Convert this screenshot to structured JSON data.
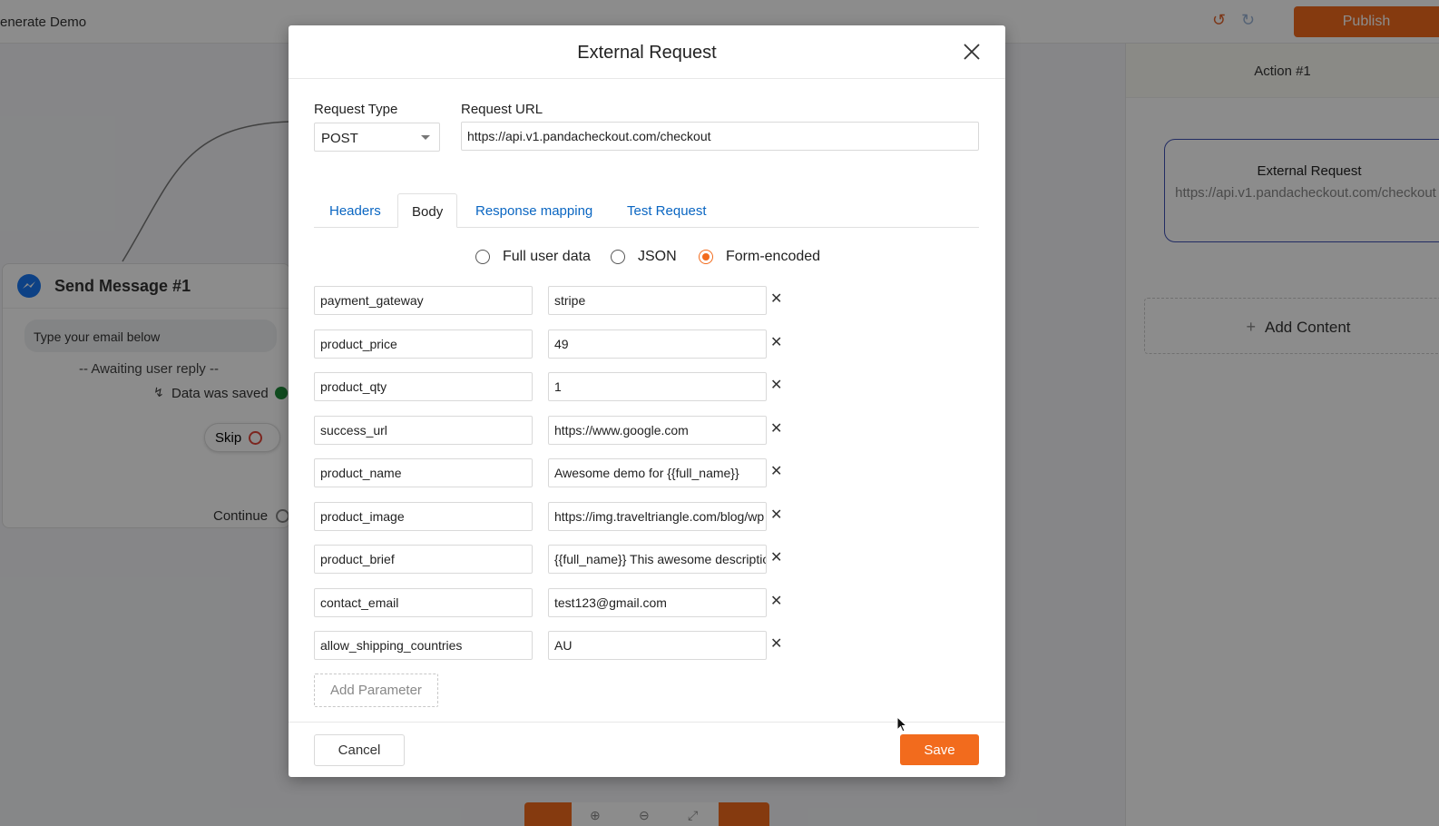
{
  "app": {
    "title": "enerate Demo",
    "publish_label": "Publish",
    "undo_icon": "undo-icon",
    "redo_icon": "redo-icon"
  },
  "canvas": {
    "node": {
      "title": "Send Message #1",
      "icon": "messenger-icon",
      "bubble_text": "Type your email below",
      "awaiting_text": "-- Awaiting user reply --",
      "saved_text": "Data was saved",
      "skip_label": "Skip",
      "continue_label": "Continue"
    }
  },
  "right_panel": {
    "header": "Action #1",
    "card": {
      "title": "External Request",
      "url": "https://api.v1.pandacheckout.com/checkout"
    },
    "add_content_label": "Add Content"
  },
  "modal": {
    "title": "External Request",
    "request_type_label": "Request Type",
    "request_type_value": "POST",
    "request_url_label": "Request URL",
    "request_url_value": "https://api.v1.pandacheckout.com/checkout",
    "tabs": [
      {
        "label": "Headers",
        "active": false
      },
      {
        "label": "Body",
        "active": true
      },
      {
        "label": "Response mapping",
        "active": false
      },
      {
        "label": "Test Request",
        "active": false
      }
    ],
    "body_formats": [
      {
        "label": "Full user data",
        "selected": false
      },
      {
        "label": "JSON",
        "selected": false
      },
      {
        "label": "Form-encoded",
        "selected": true
      }
    ],
    "params": [
      {
        "key": "payment_gateway",
        "value": "stripe"
      },
      {
        "key": "product_price",
        "value": "49"
      },
      {
        "key": "product_qty",
        "value": "1"
      },
      {
        "key": "success_url",
        "value": "https://www.google.com"
      },
      {
        "key": "product_name",
        "value": "Awesome demo for {{full_name}}"
      },
      {
        "key": "product_image",
        "value": "https://img.traveltriangle.com/blog/wp"
      },
      {
        "key": "product_brief",
        "value": "{{full_name}} This awesome description"
      },
      {
        "key": "contact_email",
        "value": "test123@gmail.com"
      },
      {
        "key": "allow_shipping_countries",
        "value": "AU"
      }
    ],
    "add_parameter_label": "Add Parameter",
    "cancel_label": "Cancel",
    "save_label": "Save",
    "accent_color": "#f26b1d",
    "link_color": "#0a66c2"
  }
}
